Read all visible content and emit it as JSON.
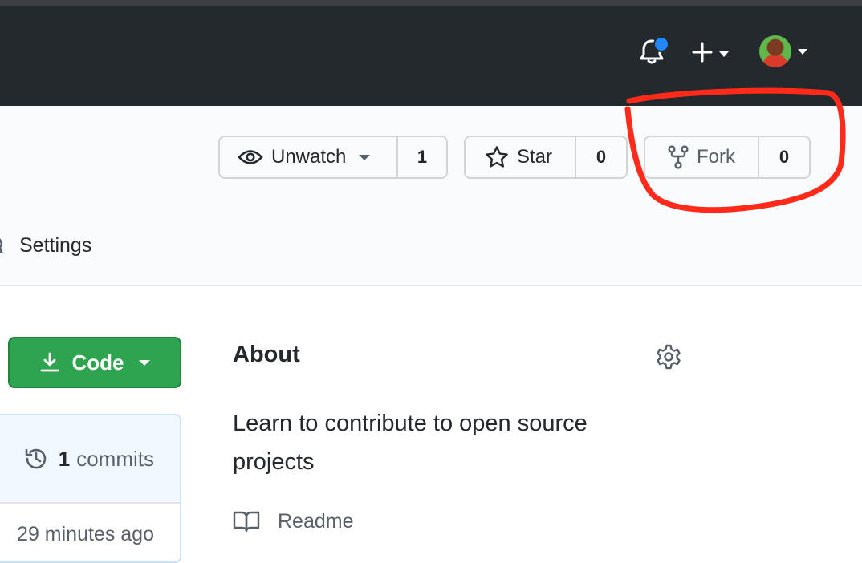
{
  "header": {
    "notifications_icon": "bell-icon",
    "new_menu_icon": "plus-icon",
    "avatar_icon": "avatar"
  },
  "repo_actions": {
    "watch": {
      "label": "Unwatch",
      "count": "1",
      "icon": "eye-icon"
    },
    "star": {
      "label": "Star",
      "count": "0",
      "icon": "star-icon"
    },
    "fork": {
      "label": "Fork",
      "count": "0",
      "icon": "repo-forked-icon"
    }
  },
  "nav": {
    "settings_label": "Settings"
  },
  "code_button": {
    "label": "Code",
    "icon": "download-icon"
  },
  "commits": {
    "count": "1",
    "label": "commits",
    "time": "29 minutes ago"
  },
  "about": {
    "title": "About",
    "description": "Learn to contribute to open source projects",
    "readme_label": "Readme"
  },
  "colors": {
    "header_bg": "#24292e",
    "notification_dot": "#2188ff",
    "code_green": "#2ea44f",
    "annotation_red": "#ff2a1a"
  }
}
